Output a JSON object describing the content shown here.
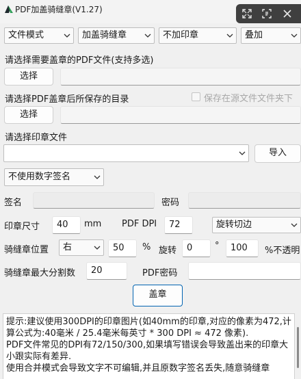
{
  "window": {
    "title": "PDF加盖骑缝章(V1.27)",
    "overlay_icons": [
      "fullscreen-icon",
      "capture-icon",
      "close-icon"
    ]
  },
  "top_selects": {
    "mode": "文件模式",
    "stamp_type": "加盖骑缝章",
    "seal_option": "不加印章",
    "overlay_mode": "叠加"
  },
  "pdf_section": {
    "label": "请选择需要盖章的PDF文件(支持多选)",
    "button": "选择",
    "path": ""
  },
  "output_section": {
    "label": "请选择PDF盖章后所保存的目录",
    "checkbox_label": "保存在源文件文件夹下",
    "checkbox_checked": false,
    "button": "选择",
    "path": ""
  },
  "seal_section": {
    "label": "请选择印章文件",
    "file": "",
    "import_button": "导入"
  },
  "signature": {
    "select": "不使用数字签名",
    "name_label": "签名",
    "name_value": "",
    "password_label": "密码",
    "password_value": ""
  },
  "size_row": {
    "label": "印章尺寸",
    "value": "40",
    "unit": "mm",
    "dpi_label": "PDF DPI",
    "dpi_value": "72",
    "rotation_mode": "旋转切边"
  },
  "position_row": {
    "label": "骑缝章位置",
    "side": "右",
    "percent_value": "50",
    "percent_unit": "%",
    "rotate_label": "旋转",
    "rotate_value": "0",
    "degree_unit": "°",
    "opacity_value": "100",
    "opacity_label": "%不透明"
  },
  "split_row": {
    "label": "骑缝章最大分割数",
    "value": "20",
    "pdf_password_label": "PDF密码",
    "pdf_password_value": ""
  },
  "stamp_button": "盖章",
  "tips": [
    "提示:建议使用300DPI的印章图片(如40mm的印章,对应的像素为472,计算公式为:40毫米 / 25.4毫米每英寸 * 300 DPI ≈ 472 像素).",
    "PDF文件常见的DPI有72/150/300,如果填写错误会导致盖出来的印章大小跟实际有差异.",
    "使用合并模式会导致文字不可编辑,并且原数字签名丢失,随意骑缝章"
  ]
}
